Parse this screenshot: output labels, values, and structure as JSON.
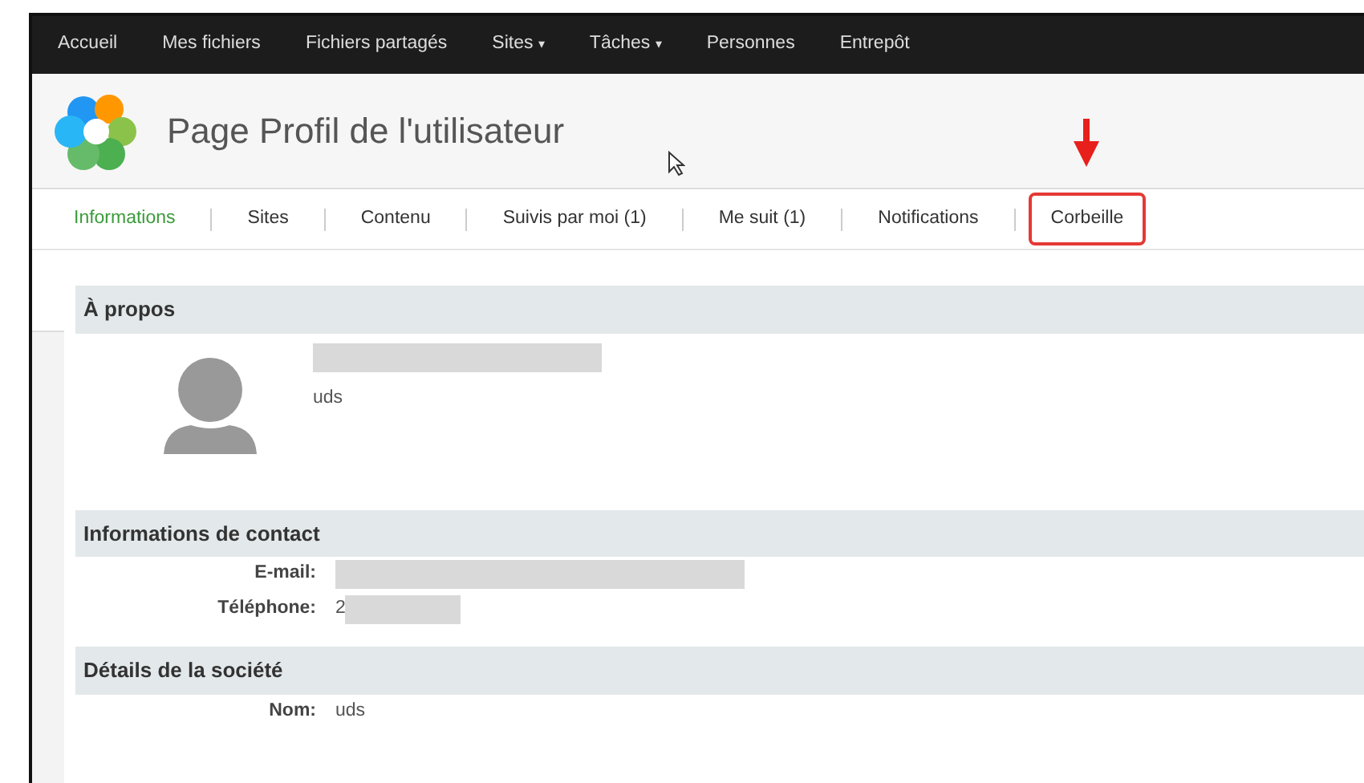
{
  "nav": [
    {
      "label": "Accueil"
    },
    {
      "label": "Mes fichiers"
    },
    {
      "label": "Fichiers partagés"
    },
    {
      "label": "Sites",
      "caret": "▾"
    },
    {
      "label": "Tâches",
      "caret": "▾"
    },
    {
      "label": "Personnes"
    },
    {
      "label": "Entrepôt"
    }
  ],
  "page_title": "Page Profil de l'utilisateur",
  "tabs": [
    {
      "label": "Informations",
      "selected": true,
      "highlighted": false
    },
    {
      "label": "Sites",
      "selected": false,
      "highlighted": false
    },
    {
      "label": "Contenu",
      "selected": false,
      "highlighted": false
    },
    {
      "label": "Suivis par moi (1)",
      "selected": false,
      "highlighted": false
    },
    {
      "label": "Me suit (1)",
      "selected": false,
      "highlighted": false
    },
    {
      "label": "Notifications",
      "selected": false,
      "highlighted": false
    },
    {
      "label": "Corbeille",
      "selected": false,
      "highlighted": true
    }
  ],
  "about": {
    "heading": "À propos",
    "username": "uds"
  },
  "contact": {
    "heading": "Informations de contact",
    "fields": [
      {
        "label": "E-mail:",
        "kind": "redacted"
      },
      {
        "label": "Téléphone:",
        "kind": "redacted",
        "value": "2"
      }
    ]
  },
  "company": {
    "heading": "Détails de la société",
    "fields": [
      {
        "label": "Nom:",
        "kind": "text",
        "value": "uds"
      }
    ]
  }
}
